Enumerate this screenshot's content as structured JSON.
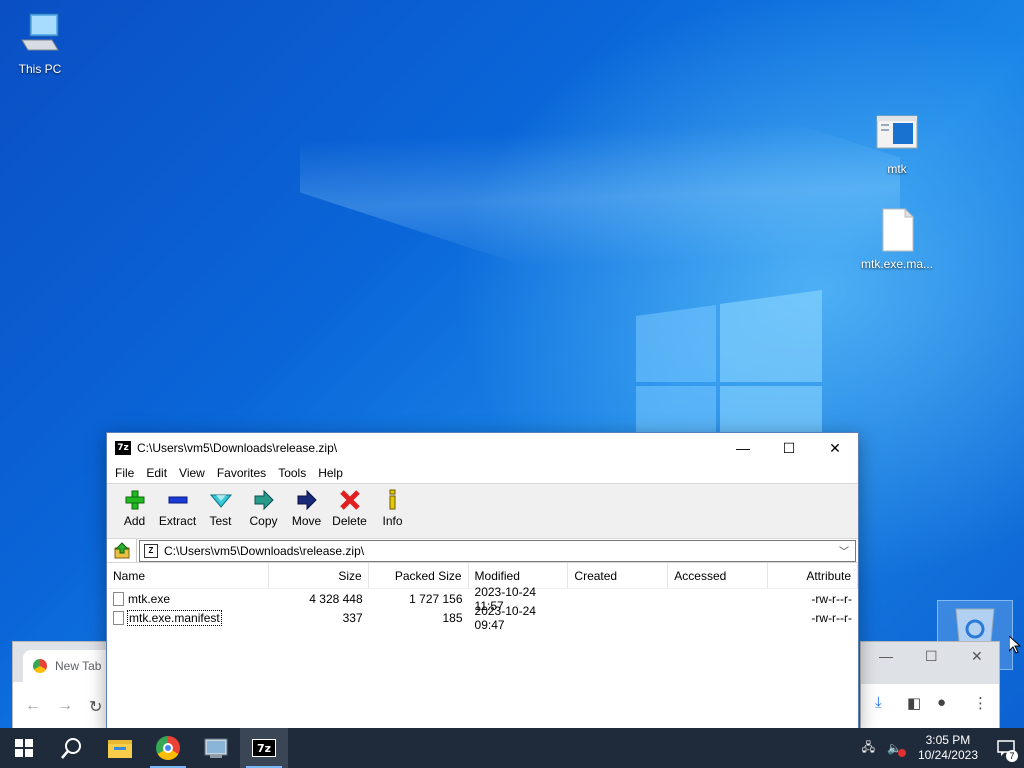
{
  "desktop": {
    "icons": [
      {
        "label": "This PC"
      },
      {
        "label": "mtk"
      },
      {
        "label": "mtk.exe.ma..."
      }
    ]
  },
  "chrome_window": {
    "tab_label": "New Tab"
  },
  "sevenzip": {
    "title": "C:\\Users\\vm5\\Downloads\\release.zip\\",
    "menu": [
      "File",
      "Edit",
      "View",
      "Favorites",
      "Tools",
      "Help"
    ],
    "toolbar": [
      "Add",
      "Extract",
      "Test",
      "Copy",
      "Move",
      "Delete",
      "Info"
    ],
    "address": "C:\\Users\\vm5\\Downloads\\release.zip\\",
    "columns": [
      "Name",
      "Size",
      "Packed Size",
      "Modified",
      "Created",
      "Accessed",
      "Attribute"
    ],
    "rows": [
      {
        "name": "mtk.exe",
        "size": "4 328 448",
        "packed": "1 727 156",
        "modified": "2023-10-24 11:57",
        "created": "",
        "accessed": "",
        "attr": "-rw-r--r-"
      },
      {
        "name": "mtk.exe.manifest",
        "size": "337",
        "packed": "185",
        "modified": "2023-10-24 09:47",
        "created": "",
        "accessed": "",
        "attr": "-rw-r--r-"
      }
    ]
  },
  "taskbar": {
    "time": "3:05 PM",
    "date": "10/24/2023",
    "notification_count": "7"
  },
  "colors": {
    "desktop_blue": "#0a66d8",
    "taskbar": "#1f2b3a",
    "add_green": "#22b822",
    "delete_red": "#e02020",
    "info_yellow": "#e8c800"
  },
  "icons": {
    "start": "windows-logo-icon",
    "search": "search-icon",
    "explorer": "folder-icon",
    "chrome": "chrome-icon",
    "control_panel": "control-panel-icon",
    "sevenzip": "7zip-icon"
  }
}
